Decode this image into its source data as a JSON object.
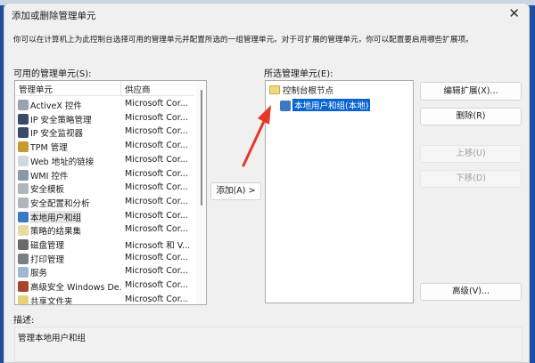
{
  "dialog": {
    "title": "添加或删除管理单元",
    "intro": "你可以在计算机上为此控制台选择可用的管理单元并配置所选的一组管理单元。对于可扩展的管理单元，你可以配置要启用哪些扩展项。"
  },
  "available": {
    "label": "可用的管理单元(S):",
    "col_name": "管理单元",
    "col_vendor": "供应商",
    "items": [
      {
        "name": "ActiveX 控件",
        "vendor": "Microsoft Cor...",
        "color": "#9aa3ad"
      },
      {
        "name": "IP 安全策略管理",
        "vendor": "Microsoft Cor...",
        "color": "#3b4a6b"
      },
      {
        "name": "IP 安全监视器",
        "vendor": "Microsoft Cor...",
        "color": "#3b4a6b"
      },
      {
        "name": "TPM 管理",
        "vendor": "Microsoft Cor...",
        "color": "#c79a2c"
      },
      {
        "name": "Web 地址的链接",
        "vendor": "Microsoft Cor...",
        "color": "#cfd8dc"
      },
      {
        "name": "WMI 控件",
        "vendor": "Microsoft Cor...",
        "color": "#8a99a8"
      },
      {
        "name": "安全模板",
        "vendor": "Microsoft Cor...",
        "color": "#b0b6bc"
      },
      {
        "name": "安全配置和分析",
        "vendor": "Microsoft Cor...",
        "color": "#b0b6bc"
      },
      {
        "name": "本地用户和组",
        "vendor": "Microsoft Cor...",
        "color": "#3a78c8"
      },
      {
        "name": "策略的结果集",
        "vendor": "Microsoft Cor...",
        "color": "#e8d9a6"
      },
      {
        "name": "磁盘管理",
        "vendor": "Microsoft 和 V...",
        "color": "#6b6b6b"
      },
      {
        "name": "打印管理",
        "vendor": "Microsoft Cor...",
        "color": "#7a7f86"
      },
      {
        "name": "服务",
        "vendor": "Microsoft Cor...",
        "color": "#9fb8d6"
      },
      {
        "name": "高级安全 Windows De...",
        "vendor": "Microsoft Cor...",
        "color": "#a8442a"
      },
      {
        "name": "共享文件夹",
        "vendor": "Microsoft Cor...",
        "color": "#e8cf7a"
      }
    ]
  },
  "add_button": "添加(A) >",
  "selected": {
    "label": "所选管理单元(E):",
    "root": "控制台根节点",
    "child": "本地用户和组(本地)"
  },
  "buttons": {
    "edit_ext": "编辑扩展(X)...",
    "remove": "删除(R)",
    "move_up": "上移(U)",
    "move_down": "下移(D)",
    "advanced": "高级(V)..."
  },
  "description": {
    "label": "描述:",
    "text": "管理本地用户和组"
  },
  "annotation_color": "#e8362a"
}
